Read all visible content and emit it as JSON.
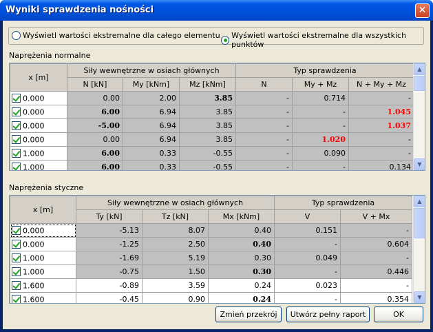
{
  "window": {
    "title": "Wyniki sprawdzenia nośności"
  },
  "options": {
    "radio_element": "Wyświetl wartości ekstremalne dla całego elementu",
    "radio_points": "Wyświetl wartości ekstremalne dla wszystkich punktów",
    "selected": "points"
  },
  "normal": {
    "section_label": "Naprężenia normalne",
    "x_header": "x [m]",
    "forces_header": "Siły wewnętrzne w osiach głównych",
    "check_header": "Typ sprawdzenia",
    "columns": [
      "N [kN]",
      "My [kNm]",
      "Mz [kNm]",
      "N",
      "My + Mz",
      "N + My + Mz"
    ],
    "rows": [
      {
        "x": "0.000",
        "cells": [
          "0.00",
          "2.00",
          "3.85",
          "-",
          "0.714",
          "-"
        ]
      },
      {
        "x": "0.000",
        "cells": [
          "6.00",
          "6.94",
          "3.85",
          "-",
          "-",
          "1.045"
        ]
      },
      {
        "x": "0.000",
        "cells": [
          "-5.00",
          "6.94",
          "3.85",
          "-",
          "-",
          "1.037"
        ]
      },
      {
        "x": "0.000",
        "cells": [
          "0.00",
          "6.94",
          "3.85",
          "-",
          "1.020",
          "-"
        ]
      },
      {
        "x": "1.000",
        "cells": [
          "6.00",
          "0.33",
          "-0.55",
          "-",
          "0.090",
          "-"
        ]
      },
      {
        "x": "1.000",
        "cells": [
          "6.00",
          "0.33",
          "-0.55",
          "-",
          "-",
          "0.134"
        ]
      }
    ]
  },
  "shear": {
    "section_label": "Naprężenia styczne",
    "x_header": "x [m]",
    "forces_header": "Siły wewnętrzne w osiach głównych",
    "check_header": "Typ sprawdzenia",
    "columns": [
      "Ty [kN]",
      "Tz [kN]",
      "Mx [kNm]",
      "V",
      "V + Mx"
    ],
    "rows": [
      {
        "x": "0.000",
        "cells": [
          "-5.13",
          "8.07",
          "0.40",
          "0.151",
          "-"
        ]
      },
      {
        "x": "0.000",
        "cells": [
          "-1.25",
          "2.50",
          "0.40",
          "-",
          "0.604"
        ]
      },
      {
        "x": "1.000",
        "cells": [
          "-1.69",
          "5.19",
          "0.30",
          "0.049",
          "-"
        ]
      },
      {
        "x": "1.000",
        "cells": [
          "-0.75",
          "1.50",
          "0.30",
          "-",
          "0.446"
        ]
      },
      {
        "x": "1.600",
        "cells": [
          "-0.89",
          "3.59",
          "0.24",
          "0.023",
          "-"
        ]
      },
      {
        "x": "1.600",
        "cells": [
          "-0.45",
          "0.90",
          "0.24",
          "-",
          "0.354"
        ]
      }
    ]
  },
  "buttons": {
    "change_section": "Zmień przekrój",
    "full_report": "Utwórz pełny raport",
    "ok": "OK"
  },
  "colors": {
    "titlebar": "#0054e3",
    "exceeded": "#ff0000",
    "client": "#ece9d8"
  }
}
